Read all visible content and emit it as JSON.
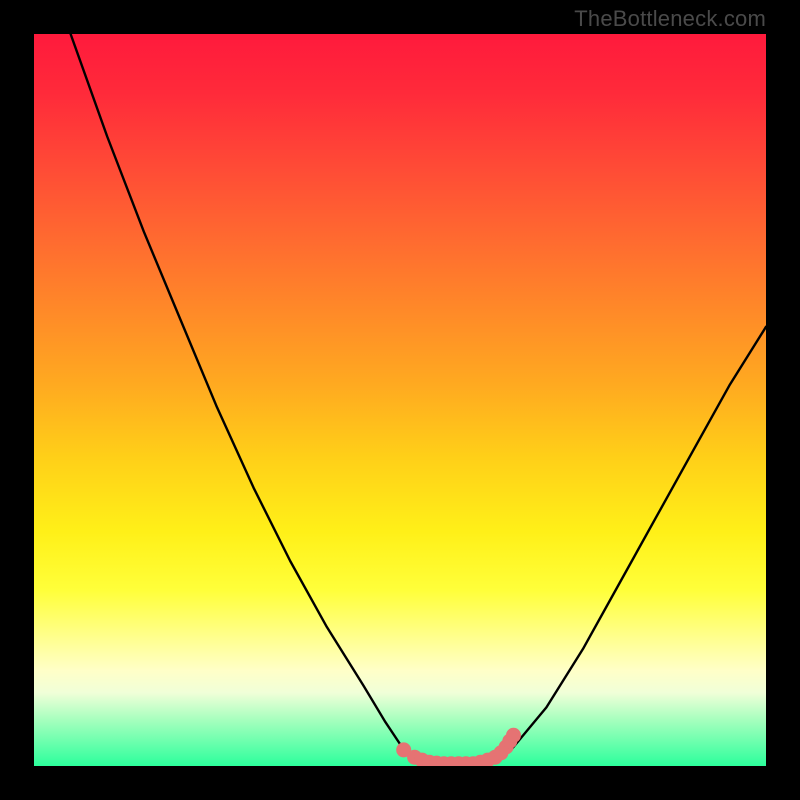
{
  "credit": "TheBottleneck.com",
  "colors": {
    "frame": "#000000",
    "curve": "#000000",
    "marker_fill": "#e57373",
    "marker_stroke": "#d65a5a"
  },
  "chart_data": {
    "type": "line",
    "title": "",
    "xlabel": "",
    "ylabel": "",
    "xlim": [
      0,
      100
    ],
    "ylim": [
      0,
      100
    ],
    "grid": false,
    "series": [
      {
        "name": "bottleneck-curve",
        "x": [
          5,
          10,
          15,
          20,
          25,
          30,
          35,
          40,
          45,
          48,
          50,
          52,
          55,
          57,
          60,
          62,
          65,
          70,
          75,
          80,
          85,
          90,
          95,
          100
        ],
        "y": [
          100,
          86,
          73,
          61,
          49,
          38,
          28,
          19,
          11,
          6,
          3,
          1.5,
          0.7,
          0.3,
          0.3,
          0.7,
          2,
          8,
          16,
          25,
          34,
          43,
          52,
          60
        ]
      }
    ],
    "flat_markers": {
      "name": "optimal-range-markers",
      "x": [
        50.5,
        52,
        53,
        54,
        55,
        56,
        57,
        58,
        59,
        60,
        61,
        62,
        63,
        63.8,
        64.5,
        65,
        65.5
      ],
      "y": [
        2.2,
        1.2,
        0.8,
        0.5,
        0.4,
        0.3,
        0.3,
        0.3,
        0.3,
        0.3,
        0.5,
        0.8,
        1.2,
        1.8,
        2.6,
        3.4,
        4.2
      ]
    }
  }
}
